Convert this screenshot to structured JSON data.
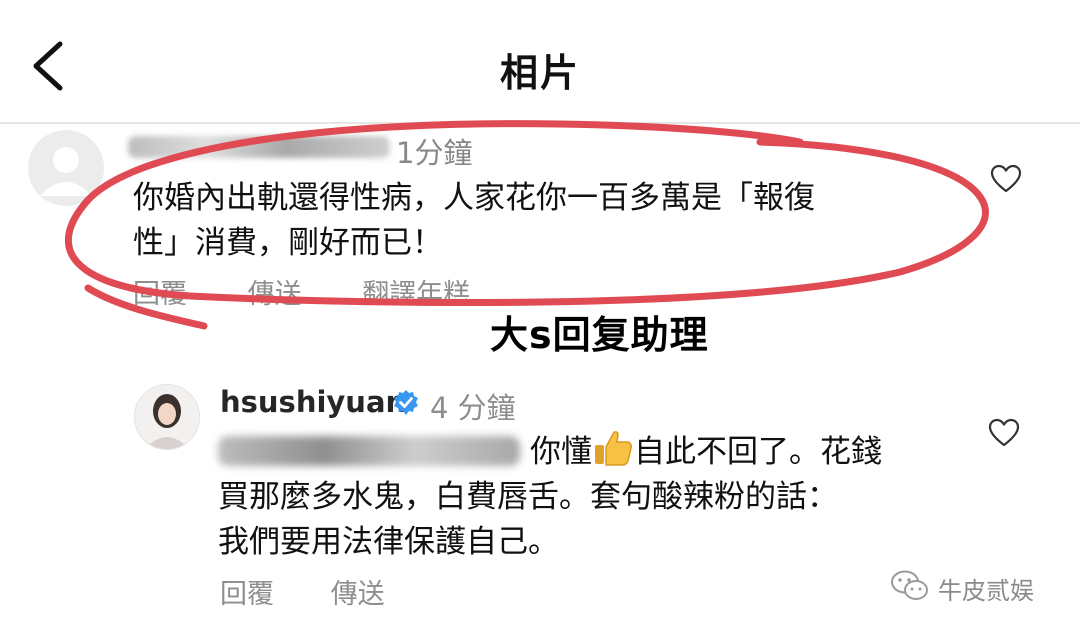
{
  "header": {
    "title": "相片"
  },
  "comment1": {
    "time": "1分鐘",
    "text_line1": "你婚內出軌還得性病，人家花你一百多萬是「報復",
    "text_line2": "性」消費，剛好而已！",
    "actions": {
      "reply": "回覆",
      "send": "傳送",
      "translate": "翻譯年糕"
    }
  },
  "annotation": "大s回复助理",
  "comment2": {
    "username": "hsushiyuan",
    "time": "4 分鐘",
    "text_line1_suffix": "你懂",
    "text_line1_tail": "自此不回了。花錢",
    "text_line2": "買那麼多水鬼，白費唇舌。套句酸辣粉的話：",
    "text_line3": "我們要用法律保護自己。",
    "actions": {
      "reply": "回覆",
      "send": "傳送"
    }
  },
  "watermark": "牛皮贰娱",
  "icons": {
    "back": "chevron-left-icon",
    "like": "heart-icon",
    "verified": "verified-badge-icon",
    "emoji": "thumbs-up-icon",
    "watermark_logo": "wechat-icon"
  },
  "colors": {
    "annotation_stroke": "#e04a52",
    "verified": "#3897f0",
    "muted_text": "#8e8e8e"
  }
}
